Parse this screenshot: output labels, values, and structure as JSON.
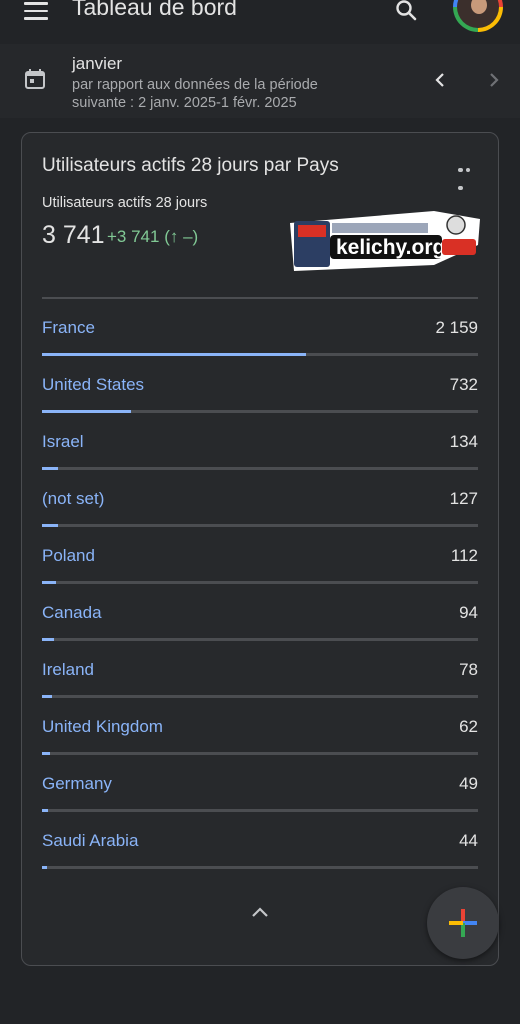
{
  "header": {
    "title": "Tableau de bord",
    "icons": [
      "menu-icon",
      "search-icon",
      "avatar"
    ]
  },
  "date_range": {
    "month": "janvier",
    "comparison": "par rapport aux données de la période suivante : 2 janv. 2025-1 févr. 2025"
  },
  "card": {
    "title": "Utilisateurs actifs 28 jours par Pays",
    "metric_label": "Utilisateurs actifs 28 jours",
    "metric_value": "3 741",
    "metric_delta": "+3 741 (↑ –)",
    "sticker_text": "kelichy.org",
    "sticker_badges": [
      "NEWS",
      "BREAKING NEWS"
    ],
    "rows": [
      {
        "country": "France",
        "users": "2 159",
        "share": 1.0
      },
      {
        "country": "United States",
        "users": "732",
        "share": 0.339
      },
      {
        "country": "Israel",
        "users": "134",
        "share": 0.062
      },
      {
        "country": "(not set)",
        "users": "127",
        "share": 0.059
      },
      {
        "country": "Poland",
        "users": "112",
        "share": 0.052
      },
      {
        "country": "Canada",
        "users": "94",
        "share": 0.044
      },
      {
        "country": "Ireland",
        "users": "78",
        "share": 0.036
      },
      {
        "country": "United Kingdom",
        "users": "62",
        "share": 0.029
      },
      {
        "country": "Germany",
        "users": "49",
        "share": 0.023
      },
      {
        "country": "Saudi Arabia",
        "users": "44",
        "share": 0.02
      }
    ]
  },
  "colors": {
    "background": "#222427",
    "card": "#27292c",
    "link_blue": "#8ab4f8",
    "delta_green": "#81c995",
    "divider": "#4b4d51"
  }
}
